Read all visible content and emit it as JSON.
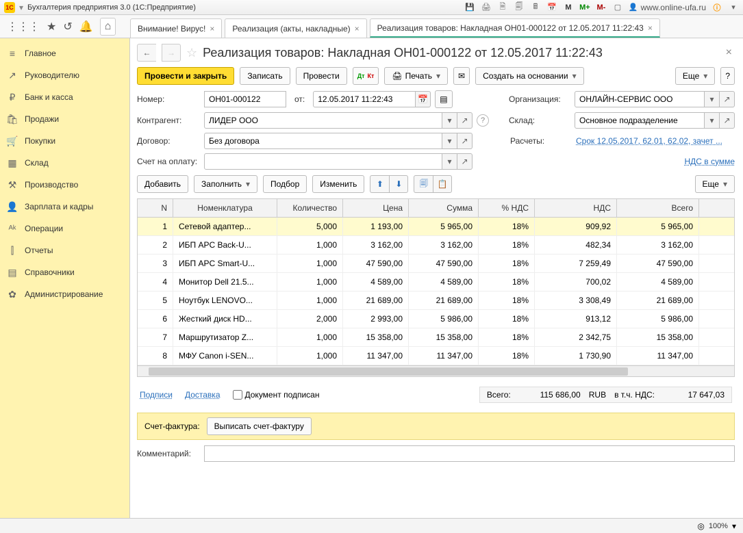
{
  "app_title": "Бухгалтерия предприятия 3.0   (1С:Предприятие)",
  "top_user": "www.online-ufa.ru",
  "top_icons": {
    "m": "M",
    "m_plus": "M+",
    "m_minus": "M-"
  },
  "sidebar": [
    {
      "icon": "≡",
      "label": "Главное"
    },
    {
      "icon": "↗",
      "label": "Руководителю"
    },
    {
      "icon": "₽",
      "label": "Банк и касса"
    },
    {
      "icon": "🛍",
      "label": "Продажи"
    },
    {
      "icon": "🛒",
      "label": "Покупки"
    },
    {
      "icon": "▦",
      "label": "Склад"
    },
    {
      "icon": "⚒",
      "label": "Производство"
    },
    {
      "icon": "👤",
      "label": "Зарплата и кадры"
    },
    {
      "icon": "ᴬᵏ",
      "label": "Операции"
    },
    {
      "icon": "⫿",
      "label": "Отчеты"
    },
    {
      "icon": "▤",
      "label": "Справочники"
    },
    {
      "icon": "✿",
      "label": "Администрирование"
    }
  ],
  "sidebar_footer": "www.online-ufa.ru",
  "tabs": [
    {
      "label": "Внимание! Вирус!",
      "active": false
    },
    {
      "label": "Реализация (акты, накладные)",
      "active": false
    },
    {
      "label": "Реализация товаров: Накладная ОН01-000122 от 12.05.2017 11:22:43",
      "active": true
    }
  ],
  "doc_title": "Реализация товаров: Накладная ОН01-000122 от 12.05.2017 11:22:43",
  "buttons": {
    "post_close": "Провести и закрыть",
    "write": "Записать",
    "post": "Провести",
    "print": "Печать",
    "create_on": "Создать на основании",
    "more": "Еще",
    "help": "?"
  },
  "form": {
    "number_lbl": "Номер:",
    "number": "ОН01-000122",
    "from_lbl": "от:",
    "date": "12.05.2017 11:22:43",
    "org_lbl": "Организация:",
    "org": "ОНЛАЙН-СЕРВИС ООО",
    "contr_lbl": "Контрагент:",
    "contr": "ЛИДЕР ООО",
    "sklad_lbl": "Склад:",
    "sklad": "Основное подразделение",
    "contract_lbl": "Договор:",
    "contract": "Без договора",
    "calc_lbl": "Расчеты:",
    "calc_link": "Срок 12.05.2017, 62.01, 62.02, зачет ...",
    "invoice_lbl": "Счет на оплату:",
    "invoice": "",
    "vat_link": "НДС в сумме"
  },
  "grid_toolbar": {
    "add": "Добавить",
    "fill": "Заполнить",
    "pick": "Подбор",
    "change": "Изменить",
    "more": "Еще"
  },
  "grid_headers": {
    "n": "N",
    "nom": "Номенклатура",
    "qty": "Количество",
    "price": "Цена",
    "sum": "Сумма",
    "vatp": "% НДС",
    "vat": "НДС",
    "total": "Всего"
  },
  "rows": [
    {
      "n": "1",
      "nom": "Сетевой адаптер...",
      "qty": "5,000",
      "price": "1 193,00",
      "sum": "5 965,00",
      "vatp": "18%",
      "vat": "909,92",
      "total": "5 965,00"
    },
    {
      "n": "2",
      "nom": "ИБП APC Back-U...",
      "qty": "1,000",
      "price": "3 162,00",
      "sum": "3 162,00",
      "vatp": "18%",
      "vat": "482,34",
      "total": "3 162,00"
    },
    {
      "n": "3",
      "nom": "ИБП APC Smart-U...",
      "qty": "1,000",
      "price": "47 590,00",
      "sum": "47 590,00",
      "vatp": "18%",
      "vat": "7 259,49",
      "total": "47 590,00"
    },
    {
      "n": "4",
      "nom": "Монитор Dell 21.5...",
      "qty": "1,000",
      "price": "4 589,00",
      "sum": "4 589,00",
      "vatp": "18%",
      "vat": "700,02",
      "total": "4 589,00"
    },
    {
      "n": "5",
      "nom": "Ноутбук LENOVO...",
      "qty": "1,000",
      "price": "21 689,00",
      "sum": "21 689,00",
      "vatp": "18%",
      "vat": "3 308,49",
      "total": "21 689,00"
    },
    {
      "n": "6",
      "nom": "Жесткий диск HD...",
      "qty": "2,000",
      "price": "2 993,00",
      "sum": "5 986,00",
      "vatp": "18%",
      "vat": "913,12",
      "total": "5 986,00"
    },
    {
      "n": "7",
      "nom": "Маршрутизатор Z...",
      "qty": "1,000",
      "price": "15 358,00",
      "sum": "15 358,00",
      "vatp": "18%",
      "vat": "2 342,75",
      "total": "15 358,00"
    },
    {
      "n": "8",
      "nom": "МФУ Canon i-SEN...",
      "qty": "1,000",
      "price": "11 347,00",
      "sum": "11 347,00",
      "vatp": "18%",
      "vat": "1 730,90",
      "total": "11 347,00"
    }
  ],
  "footer": {
    "sign_link": "Подписи",
    "ship_link": "Доставка",
    "signed_lbl": "Документ подписан",
    "total_lbl": "Всего:",
    "total": "115 686,00",
    "currency": "RUB",
    "vat_lbl": "в т.ч. НДС:",
    "vat": "17 647,03",
    "inv_lbl": "Счет-фактура:",
    "inv_btn": "Выписать счет-фактуру",
    "comment_lbl": "Комментарий:",
    "comment": ""
  },
  "status": {
    "zoom": "100%"
  }
}
